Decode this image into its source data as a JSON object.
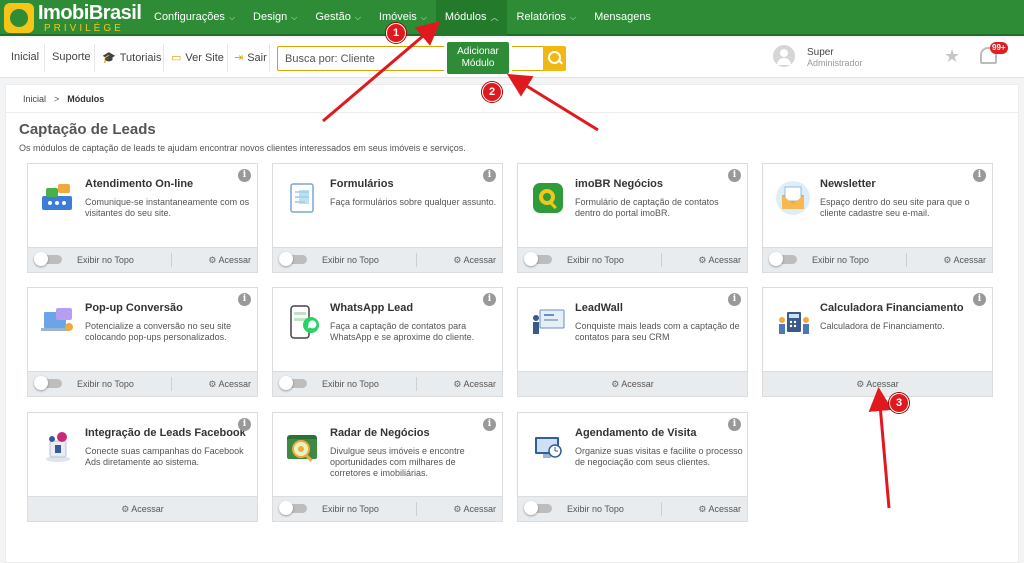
{
  "brand": {
    "name": "ImobiBrasil",
    "tagline": "PRIVILÉGE",
    "colors": {
      "primary": "#2e8b36",
      "accent": "#f0b810"
    }
  },
  "nav": [
    {
      "label": "Configurações",
      "chevron": "⌵"
    },
    {
      "label": "Design",
      "chevron": "⌵"
    },
    {
      "label": "Gestão",
      "chevron": "⌵"
    },
    {
      "label": "Imóveis",
      "chevron": "⌵"
    },
    {
      "label": "Módulos",
      "chevron": "︿"
    },
    {
      "label": "Relatórios",
      "chevron": "⌵"
    },
    {
      "label": "Mensagens",
      "chevron": ""
    }
  ],
  "toolbar": {
    "inicio": "Inicial",
    "suporte": "Suporte",
    "tutoriais": "Tutoriais",
    "ver_site": "Ver Site",
    "sair": "Sair",
    "search_placeholder": "Busca por: Cliente",
    "add_module": "Adicionar Módulo"
  },
  "user": {
    "name": "Super",
    "role": "Administrador",
    "notifications": "99+"
  },
  "breadcrumb": {
    "home": "Inicial",
    "separator": ">",
    "current": "Módulos"
  },
  "page": {
    "title": "Captação de Leads",
    "description": "Os módulos de captação de leads te ajudam encontrar novos clientes interessados em seus imóveis e serviços."
  },
  "labels": {
    "show_top": "Exibir no Topo",
    "access": "Acessar",
    "info": "i"
  },
  "cards": [
    {
      "title": "Atendimento On-line",
      "desc": "Comunique-se instantaneamente com os visitantes do seu site.",
      "toggle": true
    },
    {
      "title": "Formulários",
      "desc": "Faça formulários sobre qualquer assunto.",
      "toggle": true
    },
    {
      "title": "imoBR Negócios",
      "desc": "Formulário de captação de contatos dentro do portal imoBR.",
      "toggle": true
    },
    {
      "title": "Newsletter",
      "desc": "Espaço dentro do seu site para que o cliente cadastre seu e-mail.",
      "toggle": true
    },
    {
      "title": "Pop-up Conversão",
      "desc": "Potencialize a conversão no seu site colocando pop-ups personalizados.",
      "toggle": true
    },
    {
      "title": "WhatsApp Lead",
      "desc": "Faça a captação de contatos para WhatsApp e se aproxime do cliente.",
      "toggle": true
    },
    {
      "title": "LeadWall",
      "desc": "Conquiste mais leads com a captação de contatos para seu CRM",
      "toggle": false
    },
    {
      "title": "Calculadora Financiamento",
      "desc": "Calculadora de Financiamento.",
      "toggle": false
    },
    {
      "title": "Integração de Leads Facebook",
      "desc": "Conecte suas campanhas do Facebook Ads diretamente ao sistema.",
      "toggle": false
    },
    {
      "title": "Radar de Negócios",
      "desc": "Divulgue seus imóveis e encontre oportunidades com milhares de corretores e imobiliárias.",
      "toggle": true
    },
    {
      "title": "Agendamento de Visita",
      "desc": "Organize suas visitas e facilite o processo de negociação com seus clientes.",
      "toggle": true
    }
  ],
  "annotations": [
    "1",
    "2",
    "3"
  ]
}
